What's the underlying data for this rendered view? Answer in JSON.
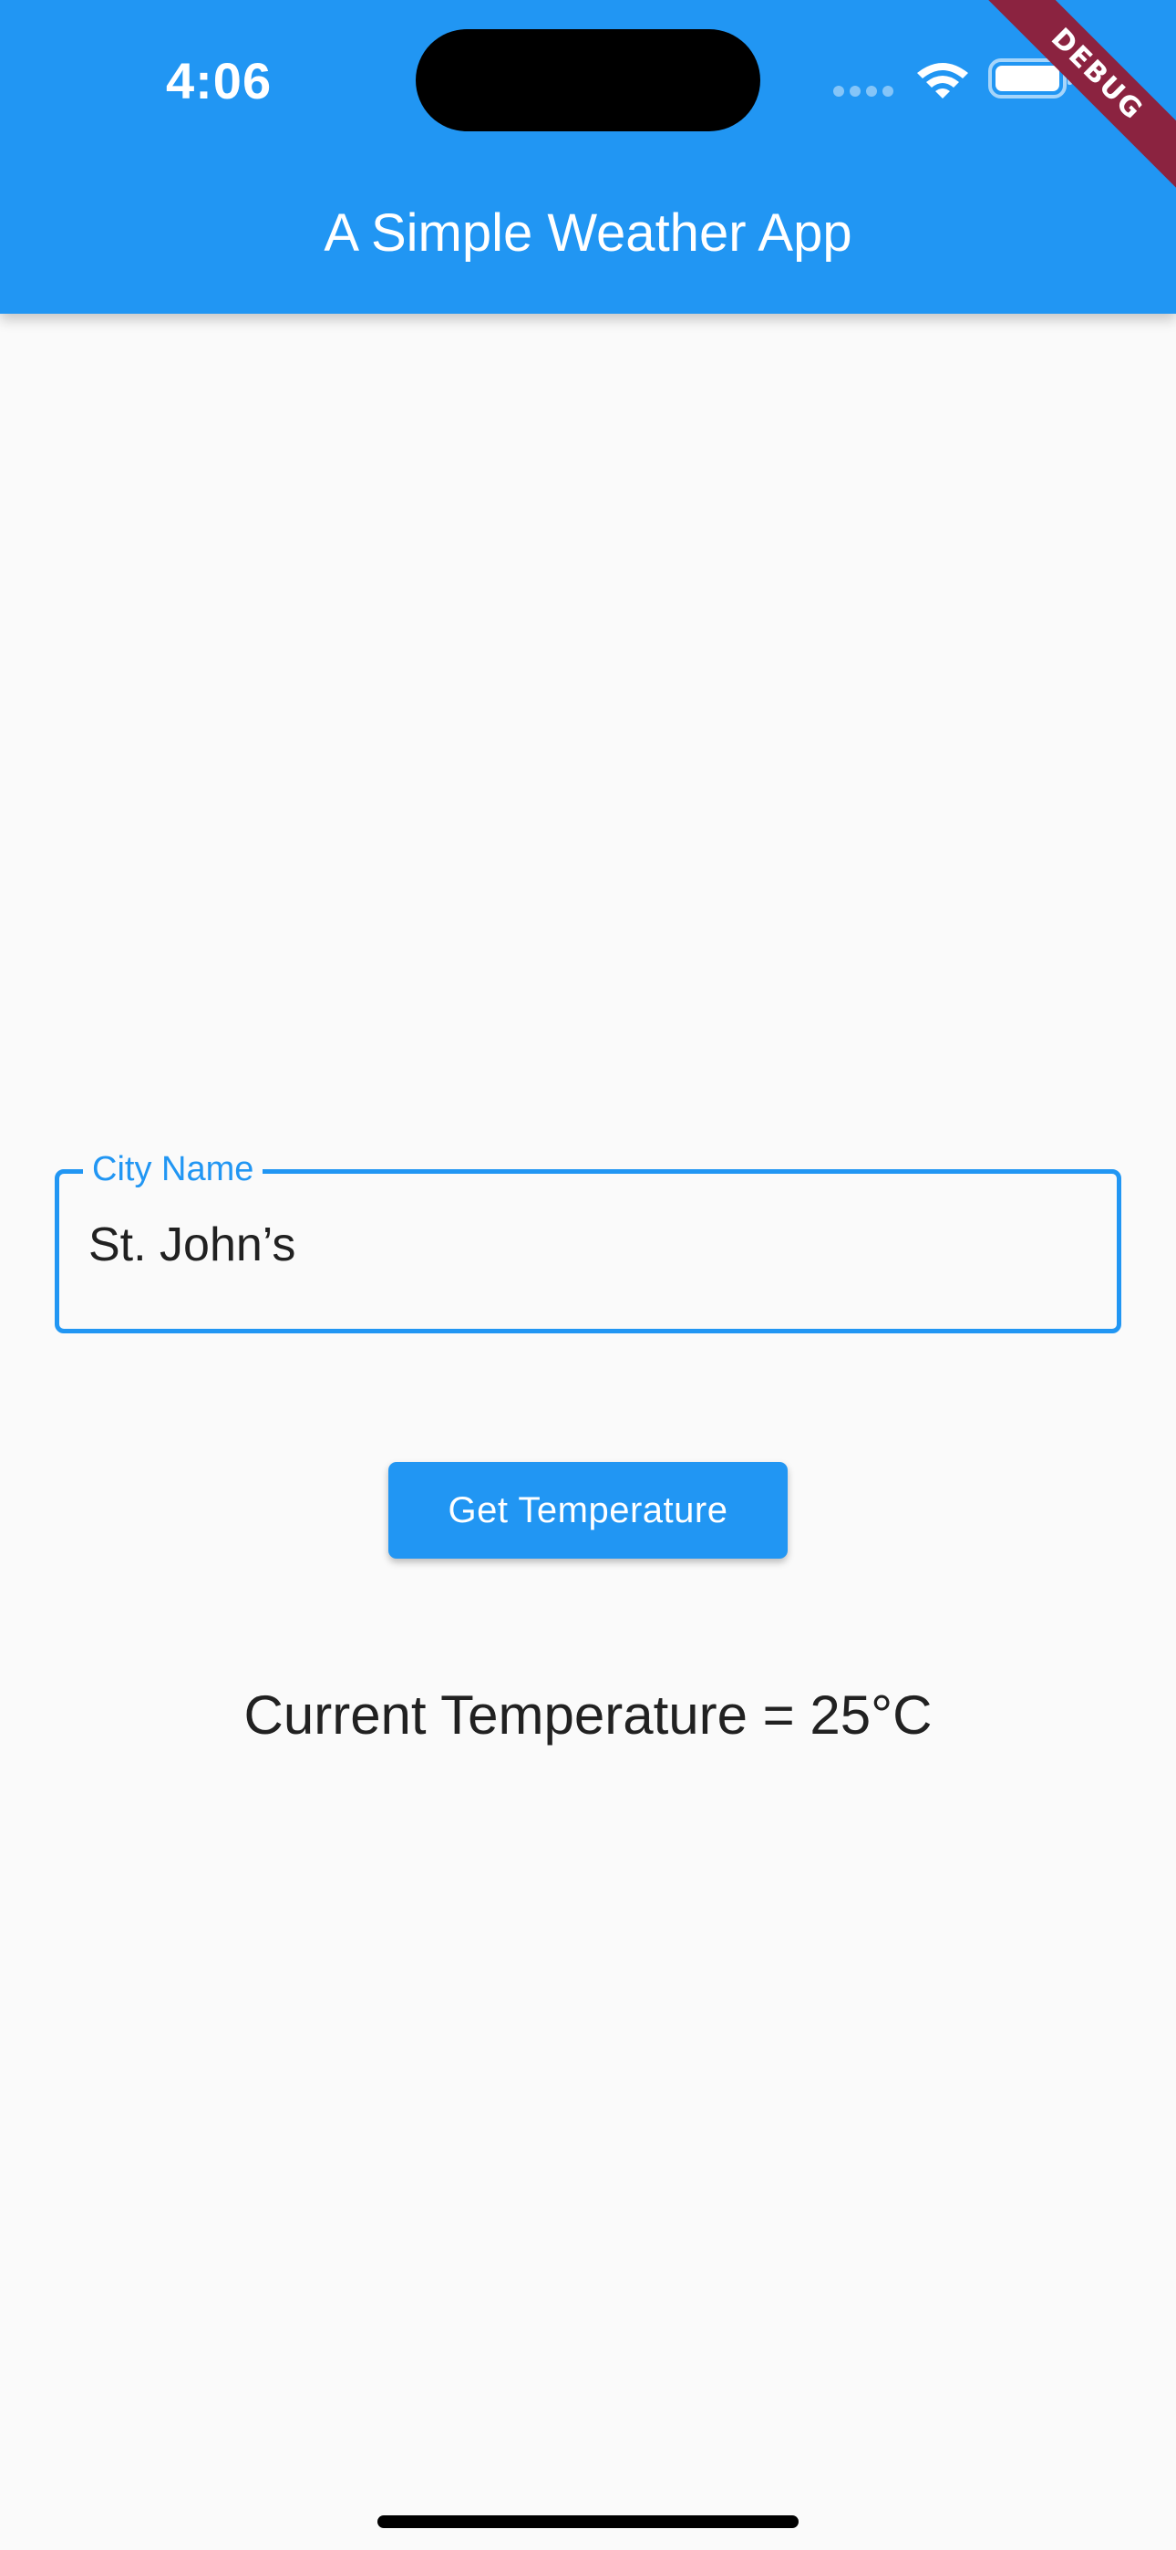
{
  "status_bar": {
    "time": "4:06"
  },
  "debug_banner": "DEBUG",
  "app_bar": {
    "title": "A Simple Weather App"
  },
  "city_field": {
    "label": "City Name",
    "value": "St. John’s"
  },
  "actions": {
    "get_temperature_label": "Get Temperature"
  },
  "result": {
    "temperature_text": "Current Temperature = 25°C"
  },
  "colors": {
    "primary": "#2196f3",
    "background": "#fafafa",
    "debug_banner": "#8b2340"
  },
  "icons": [
    "wifi-icon",
    "battery-icon",
    "signal-dots-icon"
  ]
}
